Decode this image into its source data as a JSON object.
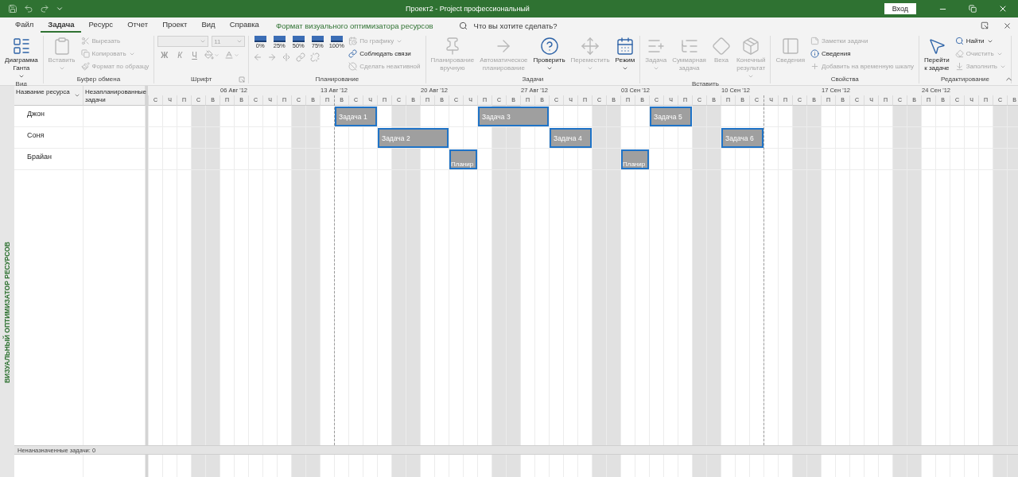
{
  "window": {
    "title": "Проект2 - Project профессиональный",
    "sign_in": "Вход"
  },
  "menu_tabs": [
    {
      "label": "Файл",
      "selected": false
    },
    {
      "label": "Задача",
      "selected": true
    },
    {
      "label": "Ресурс",
      "selected": false
    },
    {
      "label": "Отчет",
      "selected": false
    },
    {
      "label": "Проект",
      "selected": false
    },
    {
      "label": "Вид",
      "selected": false
    },
    {
      "label": "Справка",
      "selected": false
    }
  ],
  "context_tab": {
    "label": "Формат визуального оптимизатора ресурсов"
  },
  "search": {
    "placeholder": "Что вы хотите сделать?"
  },
  "ribbon_groups": [
    {
      "label": "Вид",
      "columns": [
        [
          {
            "kind": "large",
            "lines": [
              "Диаграмма",
              "Ганта"
            ],
            "dropdown": true,
            "disabled": false
          }
        ]
      ]
    },
    {
      "label": "Буфер обмена",
      "columns": [
        [
          {
            "kind": "large",
            "lines": [
              "Вставить"
            ],
            "dropdown": true,
            "disabled": true
          }
        ],
        [
          {
            "kind": "small",
            "label": "Вырезать",
            "disabled": true
          },
          {
            "kind": "small",
            "label": "Копировать",
            "dropdown": true,
            "disabled": true
          },
          {
            "kind": "small",
            "label": "Формат по образцу",
            "disabled": true
          }
        ]
      ]
    },
    {
      "label": "Шрифт",
      "launcher": true,
      "columns": [
        [
          {
            "kind": "row",
            "items": [
              {
                "kind": "combo",
                "disabled": true
              },
              {
                "kind": "combo_small",
                "value": "11",
                "disabled": true
              }
            ]
          },
          {
            "kind": "row",
            "items": [
              {
                "kind": "glyph",
                "label": "Ж",
                "disabled": true
              },
              {
                "kind": "glyph",
                "label": "К",
                "disabled": true
              },
              {
                "kind": "glyph",
                "label": "Ч",
                "disabled": true
              },
              {
                "kind": "icon",
                "dropdown": true,
                "disabled": true
              },
              {
                "kind": "icon",
                "dropdown": true,
                "disabled": true
              }
            ]
          }
        ]
      ]
    },
    {
      "label": "Планирование",
      "columns": [
        [
          {
            "kind": "row",
            "items": [
              {
                "kind": "percent",
                "label": "0%",
                "disabled": false
              },
              {
                "kind": "percent",
                "label": "25%",
                "disabled": false
              },
              {
                "kind": "percent",
                "label": "50%",
                "disabled": false
              },
              {
                "kind": "percent",
                "label": "75%",
                "disabled": false
              },
              {
                "kind": "percent",
                "label": "100%",
                "disabled": false
              }
            ]
          },
          {
            "kind": "row",
            "items": [
              {
                "kind": "icon",
                "disabled": true
              },
              {
                "kind": "icon",
                "disabled": true
              },
              {
                "kind": "icon",
                "disabled": true
              },
              {
                "kind": "icon",
                "disabled": true
              },
              {
                "kind": "icon",
                "disabled": true
              }
            ]
          }
        ],
        [
          {
            "kind": "small",
            "label": "По графику",
            "dropdown": true,
            "disabled": true
          },
          {
            "kind": "small",
            "label": "Соблюдать связи",
            "disabled": false
          },
          {
            "kind": "small",
            "label": "Сделать неактивной",
            "disabled": true
          }
        ]
      ]
    },
    {
      "label": "Задачи",
      "columns": [
        [
          {
            "kind": "large",
            "lines": [
              "Планирование",
              "вручную"
            ],
            "disabled": true
          }
        ],
        [
          {
            "kind": "large",
            "lines": [
              "Автоматическое",
              "планирование"
            ],
            "disabled": true
          }
        ],
        [
          {
            "kind": "large",
            "lines": [
              "Проверить"
            ],
            "dropdown": true,
            "disabled": false
          }
        ],
        [
          {
            "kind": "large",
            "lines": [
              "Переместить"
            ],
            "dropdown": true,
            "disabled": true
          }
        ],
        [
          {
            "kind": "large",
            "lines": [
              "Режим"
            ],
            "dropdown": true,
            "disabled": false
          }
        ]
      ]
    },
    {
      "label": "Вставить",
      "columns": [
        [
          {
            "kind": "large",
            "lines": [
              "Задача"
            ],
            "dropdown": true,
            "disabled": true
          }
        ],
        [
          {
            "kind": "large",
            "lines": [
              "Суммарная",
              "задача"
            ],
            "disabled": true
          }
        ],
        [
          {
            "kind": "large",
            "lines": [
              "Веха"
            ],
            "disabled": true
          }
        ],
        [
          {
            "kind": "large",
            "lines": [
              "Конечный",
              "результат"
            ],
            "dropdown": true,
            "disabled": true
          }
        ]
      ]
    },
    {
      "label": "Свойства",
      "columns": [
        [
          {
            "kind": "large",
            "lines": [
              "Сведения"
            ],
            "disabled": true
          }
        ],
        [
          {
            "kind": "small",
            "label": "Заметки задачи",
            "disabled": true
          },
          {
            "kind": "small",
            "label": "Сведения",
            "disabled": false
          },
          {
            "kind": "small",
            "label": "Добавить на временную шкалу",
            "disabled": true
          }
        ]
      ]
    },
    {
      "label": "Редактирование",
      "columns": [
        [
          {
            "kind": "large",
            "lines": [
              "Перейти",
              "к задаче"
            ],
            "disabled": false
          }
        ],
        [
          {
            "kind": "small",
            "label": "Найти",
            "dropdown": true,
            "disabled": false
          },
          {
            "kind": "small",
            "label": "Очистить",
            "dropdown": true,
            "disabled": true
          },
          {
            "kind": "small",
            "label": "Заполнить",
            "dropdown": true,
            "disabled": true
          }
        ]
      ]
    }
  ],
  "side_label": "ВИЗУАЛЬНЫЙ ОПТИМИЗАТОР РЕСУРСОВ",
  "table": {
    "columns": [
      "Название ресурса",
      "Незапланированные задачи"
    ],
    "rows": [
      {
        "name": "Джон",
        "assignments": [
          {
            "label": "Задача 1"
          },
          {
            "label": "Задача 3"
          },
          {
            "label": "Задача 5"
          }
        ]
      },
      {
        "name": "Соня",
        "assignments": [
          {
            "label": "Задача 2"
          },
          {
            "label": "Задача 4"
          },
          {
            "label": "Задача 6"
          }
        ]
      },
      {
        "name": "Брайан",
        "assignments": [
          {
            "label": "Планир"
          },
          {
            "label": "Планир"
          }
        ]
      }
    ]
  },
  "timescale": {
    "weeks": [
      {
        "days": [
          {
            "letter": "С",
            "weekend": false
          },
          {
            "letter": "Ч",
            "weekend": false
          },
          {
            "letter": "П",
            "weekend": false
          },
          {
            "letter": "С",
            "weekend": true
          },
          {
            "letter": "В",
            "weekend": true
          }
        ]
      },
      {
        "label": "06 Авг '12",
        "days": [
          {
            "letter": "П",
            "weekend": false
          },
          {
            "letter": "В",
            "weekend": false
          },
          {
            "letter": "С",
            "weekend": false
          },
          {
            "letter": "Ч",
            "weekend": false
          },
          {
            "letter": "П",
            "weekend": false
          },
          {
            "letter": "С",
            "weekend": true
          },
          {
            "letter": "В",
            "weekend": true
          }
        ]
      },
      {
        "label": "13 Авг '12",
        "days": [
          {
            "letter": "П",
            "weekend": false
          },
          {
            "letter": "В",
            "weekend": false
          },
          {
            "letter": "С",
            "weekend": false
          },
          {
            "letter": "Ч",
            "weekend": false
          },
          {
            "letter": "П",
            "weekend": false
          },
          {
            "letter": "С",
            "weekend": true
          },
          {
            "letter": "В",
            "weekend": true
          }
        ]
      },
      {
        "label": "20 Авг '12",
        "days": [
          {
            "letter": "П",
            "weekend": false
          },
          {
            "letter": "В",
            "weekend": false
          },
          {
            "letter": "С",
            "weekend": false
          },
          {
            "letter": "Ч",
            "weekend": false
          },
          {
            "letter": "П",
            "weekend": false
          },
          {
            "letter": "С",
            "weekend": true
          },
          {
            "letter": "В",
            "weekend": true
          }
        ]
      },
      {
        "label": "27 Авг '12",
        "days": [
          {
            "letter": "П",
            "weekend": false
          },
          {
            "letter": "В",
            "weekend": false
          },
          {
            "letter": "С",
            "weekend": false
          },
          {
            "letter": "Ч",
            "weekend": false
          },
          {
            "letter": "П",
            "weekend": false
          },
          {
            "letter": "С",
            "weekend": true
          },
          {
            "letter": "В",
            "weekend": true
          }
        ]
      },
      {
        "label": "03 Сен '12",
        "days": [
          {
            "letter": "П",
            "weekend": false
          },
          {
            "letter": "В",
            "weekend": false
          },
          {
            "letter": "С",
            "weekend": false
          },
          {
            "letter": "Ч",
            "weekend": false
          },
          {
            "letter": "П",
            "weekend": false
          },
          {
            "letter": "С",
            "weekend": true
          },
          {
            "letter": "В",
            "weekend": true
          }
        ]
      },
      {
        "label": "10 Сен '12",
        "days": [
          {
            "letter": "П",
            "weekend": false
          },
          {
            "letter": "В",
            "weekend": false
          },
          {
            "letter": "С",
            "weekend": false
          },
          {
            "letter": "Ч",
            "weekend": false
          },
          {
            "letter": "П",
            "weekend": false
          },
          {
            "letter": "С",
            "weekend": true
          },
          {
            "letter": "В",
            "weekend": true
          }
        ]
      },
      {
        "label": "17 Сен '12",
        "days": [
          {
            "letter": "П",
            "weekend": false
          },
          {
            "letter": "В",
            "weekend": false
          },
          {
            "letter": "С",
            "weekend": false
          },
          {
            "letter": "Ч",
            "weekend": false
          },
          {
            "letter": "П",
            "weekend": false
          },
          {
            "letter": "С",
            "weekend": true
          },
          {
            "letter": "В",
            "weekend": true
          }
        ]
      },
      {
        "label": "24 Сен '12",
        "days": [
          {
            "letter": "П",
            "weekend": false
          },
          {
            "letter": "В",
            "weekend": false
          },
          {
            "letter": "С",
            "weekend": false
          },
          {
            "letter": "Ч",
            "weekend": false
          },
          {
            "letter": "П",
            "weekend": false
          },
          {
            "letter": "С",
            "weekend": true
          },
          {
            "letter": "В",
            "weekend": true
          }
        ]
      }
    ]
  },
  "unassigned": "Ненаназначенные задачи: 0"
}
